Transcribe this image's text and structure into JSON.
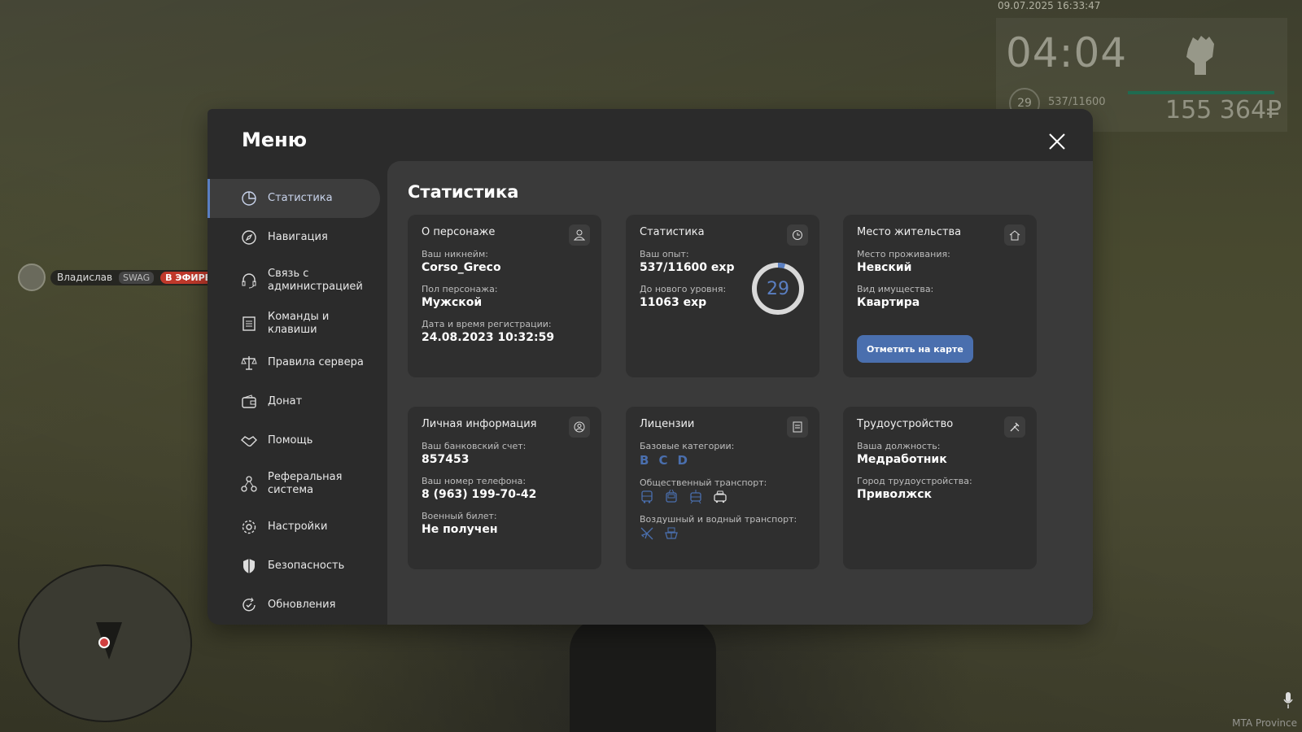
{
  "hud": {
    "datetime": "09.07.2025 16:33:47",
    "time": "04:04",
    "level": "29",
    "exp": "537/11600",
    "money": "155 364₽",
    "footer_label": "MTA Province"
  },
  "player": {
    "name": "Владислав",
    "clan": "SWAG",
    "live_badge": "В ЭФИРЕ"
  },
  "menu": {
    "title": "Меню",
    "accent": "#5a7fc2",
    "nav": [
      {
        "label": "Статистика",
        "icon": "pie-chart-icon",
        "active": true
      },
      {
        "label": "Навигация",
        "icon": "compass-icon"
      },
      {
        "label": "Связь с администрацией",
        "icon": "headset-icon"
      },
      {
        "label": "Команды и клавиши",
        "icon": "list-icon"
      },
      {
        "label": "Правила сервера",
        "icon": "scales-icon"
      },
      {
        "label": "Донат",
        "icon": "wallet-icon"
      },
      {
        "label": "Помощь",
        "icon": "handshake-icon"
      },
      {
        "label": "Реферальная система",
        "icon": "referral-icon"
      },
      {
        "label": "Настройки",
        "icon": "gear-icon"
      },
      {
        "label": "Безопасность",
        "icon": "shield-icon"
      },
      {
        "label": "Обновления",
        "icon": "refresh-check-icon"
      }
    ]
  },
  "content": {
    "title": "Статистика",
    "character": {
      "title": "О персонаже",
      "nick_label": "Ваш никнейм:",
      "nick": "Corso_Greco",
      "gender_label": "Пол персонажа:",
      "gender": "Мужской",
      "reg_label": "Дата и время регистрации:",
      "reg": "24.08.2023 10:32:59"
    },
    "stats": {
      "title": "Статистика",
      "exp_label": "Ваш опыт:",
      "exp": "537/11600 exp",
      "next_label": "До нового уровня:",
      "next": "11063 exp",
      "level": "29",
      "progress": 0.046
    },
    "residence": {
      "title": "Место жительства",
      "place_label": "Место проживания:",
      "place": "Невский",
      "type_label": "Вид имущества:",
      "type": "Квартира",
      "button": "Отметить на карте"
    },
    "personal": {
      "title": "Личная информация",
      "bank_label": "Ваш банковский счет:",
      "bank": "857453",
      "phone_label": "Ваш номер телефона:",
      "phone": "8 (963) 199-70-42",
      "military_label": "Военный билет:",
      "military": "Не получен"
    },
    "licenses": {
      "title": "Лицензии",
      "basic_label": "Базовые категории:",
      "basic": [
        "B",
        "C",
        "D"
      ],
      "public_label": "Общественный транспорт:",
      "public_icons": [
        "bus-icon",
        "trolleybus-icon",
        "tram-icon",
        "taxi-icon"
      ],
      "air_label": "Воздушный и водный транспорт:",
      "air_icons": [
        "plane-icon",
        "boat-icon"
      ]
    },
    "employment": {
      "title": "Трудоустройство",
      "job_label": "Ваша должность:",
      "job": "Медработник",
      "city_label": "Город трудоустройства:",
      "city": "Приволжск"
    }
  }
}
